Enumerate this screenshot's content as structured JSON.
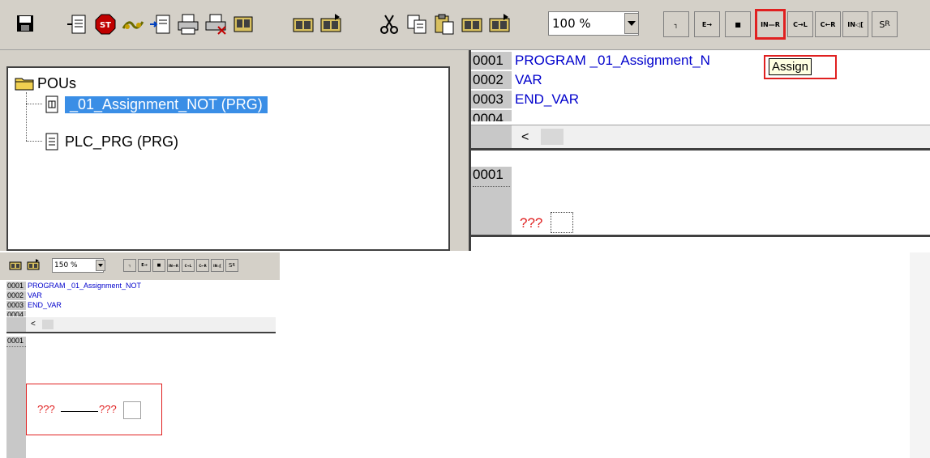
{
  "toolbar": {
    "icons": [
      "save-icon",
      "import-icon",
      "stop-icon",
      "step-icon",
      "insert-icon",
      "print-icon",
      "print-setup-icon",
      "find-icon",
      "find-next-icon",
      "find-next-replace-icon",
      "cut-icon",
      "copy-icon",
      "paste-icon",
      "replace-icon",
      "replace-all-icon"
    ],
    "zoom": "100 %",
    "ladder_buttons": [
      {
        "name": "contact-button",
        "label": "┐"
      },
      {
        "name": "parallel-contact-button",
        "label": "E→"
      },
      {
        "name": "box-button",
        "label": "■"
      },
      {
        "name": "assign-button",
        "label": "IN—R"
      },
      {
        "name": "coil-button",
        "label": "C→L"
      },
      {
        "name": "negated-coil-button",
        "label": "C←R"
      },
      {
        "name": "jump-button",
        "label": "IN◁["
      },
      {
        "name": "set-reset-button",
        "label": "S",
        "sub": "R"
      }
    ],
    "tooltip": "Assign"
  },
  "pou_tree": {
    "root": "POUs",
    "items": [
      {
        "label": "_01_Assignment_NOT (PRG)",
        "selected": true
      },
      {
        "label": "PLC_PRG (PRG)",
        "selected": false
      }
    ]
  },
  "editor_top": {
    "lines": [
      {
        "num": "0001",
        "code": "PROGRAM _01_Assignment_N"
      },
      {
        "num": "0002",
        "code": "VAR"
      },
      {
        "num": "0003",
        "code": "END_VAR"
      },
      {
        "num": "0004",
        "code": ""
      }
    ],
    "network_num": "0001",
    "network_placeholder": "???"
  },
  "mini_toolbar": {
    "zoom": "150 %",
    "ladder_labels": [
      "┐",
      "E→",
      "■",
      "IN—R",
      "C→L",
      "C←R",
      "IN◁[",
      "S",
      "R"
    ]
  },
  "mini_editor": {
    "lines": [
      {
        "num": "0001",
        "code": "PROGRAM _01_Assignment_NOT"
      },
      {
        "num": "0002",
        "code": "VAR"
      },
      {
        "num": "0003",
        "code": "END_VAR"
      },
      {
        "num": "0004",
        "code": ""
      }
    ],
    "network_num": "0001",
    "network_left": "???",
    "network_right": "???"
  }
}
